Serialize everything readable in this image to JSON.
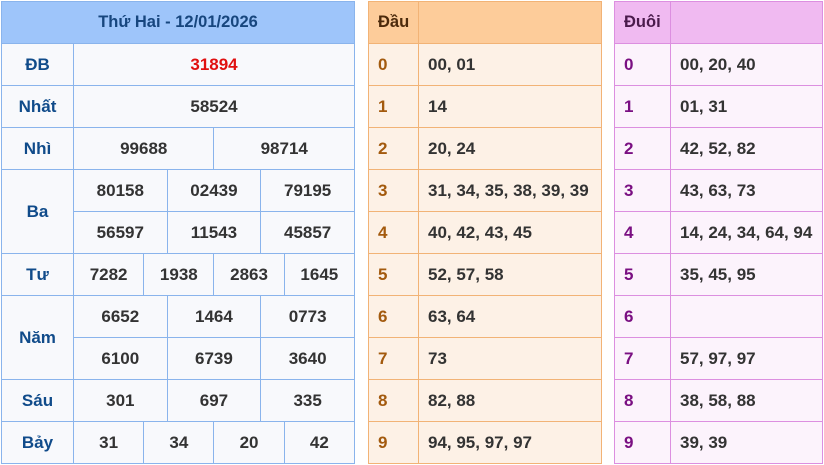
{
  "results": {
    "title": "Thứ Hai - 12/01/2026",
    "db": {
      "label": "ĐB",
      "values": [
        "31894"
      ],
      "color": "#e01010"
    },
    "nhat": {
      "label": "Nhất",
      "values": [
        "58524"
      ]
    },
    "nhi": {
      "label": "Nhì",
      "values": [
        "99688",
        "98714"
      ]
    },
    "ba": {
      "label": "Ba",
      "values": [
        "80158",
        "02439",
        "79195",
        "56597",
        "11543",
        "45857"
      ]
    },
    "tu": {
      "label": "Tư",
      "values": [
        "7282",
        "1938",
        "2863",
        "1645"
      ]
    },
    "nam": {
      "label": "Năm",
      "values": [
        "6652",
        "1464",
        "0773",
        "6100",
        "6739",
        "3640"
      ]
    },
    "sau": {
      "label": "Sáu",
      "values": [
        "301",
        "697",
        "335"
      ]
    },
    "bay": {
      "label": "Bảy",
      "values": [
        "31",
        "34",
        "20",
        "42"
      ]
    }
  },
  "dau": {
    "header": "Đầu",
    "rows": [
      {
        "digit": "0",
        "values": "00, 01"
      },
      {
        "digit": "1",
        "values": "14"
      },
      {
        "digit": "2",
        "values": "20, 24"
      },
      {
        "digit": "3",
        "values": "31, 34, 35, 38, 39, 39"
      },
      {
        "digit": "4",
        "values": "40, 42, 43, 45"
      },
      {
        "digit": "5",
        "values": "52, 57, 58"
      },
      {
        "digit": "6",
        "values": "63, 64"
      },
      {
        "digit": "7",
        "values": "73"
      },
      {
        "digit": "8",
        "values": "82, 88"
      },
      {
        "digit": "9",
        "values": "94, 95, 97, 97"
      }
    ]
  },
  "duoi": {
    "header": "Đuôi",
    "rows": [
      {
        "digit": "0",
        "values": "00, 20, 40"
      },
      {
        "digit": "1",
        "values": "01, 31"
      },
      {
        "digit": "2",
        "values": "42, 52, 82"
      },
      {
        "digit": "3",
        "values": "43, 63, 73"
      },
      {
        "digit": "4",
        "values": "14, 24, 34, 64, 94"
      },
      {
        "digit": "5",
        "values": "35, 45, 95"
      },
      {
        "digit": "6",
        "values": ""
      },
      {
        "digit": "7",
        "values": "57, 97, 97"
      },
      {
        "digit": "8",
        "values": "38, 58, 88"
      },
      {
        "digit": "9",
        "values": "39, 39"
      }
    ]
  },
  "colors": {
    "results_header": "#9ec5fa",
    "results_border": "#8ab4ec",
    "dau_header": "#fdcc9a",
    "dau_body": "#fdf1e6",
    "duoi_header": "#f0baf1",
    "duoi_body": "#fcf3fc",
    "special_prize": "#e01010"
  }
}
